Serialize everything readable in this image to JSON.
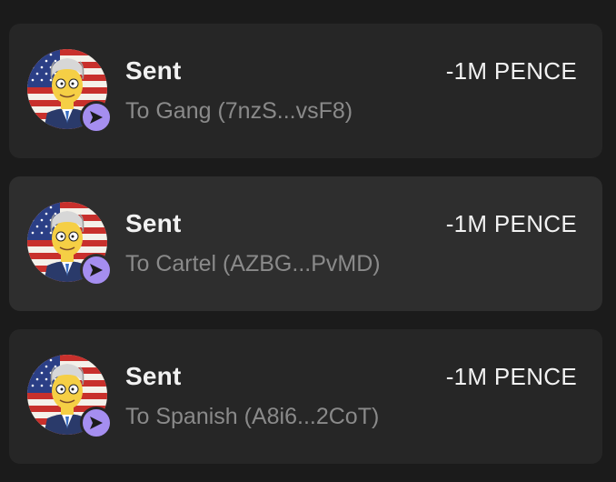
{
  "transactions": [
    {
      "title": "Sent",
      "subtitle": "To Gang (7nzS...vsF8)",
      "amount": "-1M PENCE",
      "avatar_icon": "cartoon-man-flag-avatar",
      "badge_icon": "send-arrow-icon"
    },
    {
      "title": "Sent",
      "subtitle": "To Cartel (AZBG...PvMD)",
      "amount": "-1M PENCE",
      "avatar_icon": "cartoon-man-flag-avatar",
      "badge_icon": "send-arrow-icon"
    },
    {
      "title": "Sent",
      "subtitle": "To Spanish (A8i6...2CoT)",
      "amount": "-1M PENCE",
      "avatar_icon": "cartoon-man-flag-avatar",
      "badge_icon": "send-arrow-icon"
    }
  ],
  "colors": {
    "background": "#1b1b1b",
    "card": "#262626",
    "card_highlight": "#2e2e2e",
    "badge": "#a58ef0",
    "title_text": "#f2f2f2",
    "subtitle_text": "#8a8a8a"
  }
}
